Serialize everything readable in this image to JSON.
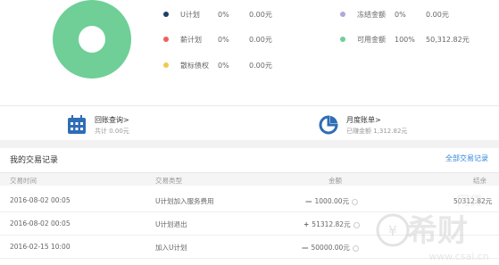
{
  "chart_data": {
    "type": "pie",
    "segments": [
      {
        "name": "U计划",
        "percent": 0,
        "amount": "0.00元",
        "color": "#1e3f66"
      },
      {
        "name": "薪计划",
        "percent": 0,
        "amount": "0.00元",
        "color": "#f0605a"
      },
      {
        "name": "散标债权",
        "percent": 0,
        "amount": "0.00元",
        "color": "#f2c94c"
      },
      {
        "name": "冻结金额",
        "percent": 0,
        "amount": "0.00元",
        "color": "#b3a7d9"
      },
      {
        "name": "可用金额",
        "percent": 100,
        "amount": "50,312.82元",
        "color": "#6fcf97"
      }
    ]
  },
  "legend": [
    {
      "name": "U计划",
      "pct": "0%",
      "amount": "0.00元",
      "color": "#1e3f66"
    },
    {
      "name": "薪计划",
      "pct": "0%",
      "amount": "0.00元",
      "color": "#f0605a"
    },
    {
      "name": "散标债权",
      "pct": "0%",
      "amount": "0.00元",
      "color": "#f2c94c"
    },
    {
      "name": "冻结金额",
      "pct": "0%",
      "amount": "0.00元",
      "color": "#b3a7d9"
    },
    {
      "name": "可用金额",
      "pct": "100%",
      "amount": "50,312.82元",
      "color": "#6fcf97"
    }
  ],
  "summary": {
    "refund": {
      "title": "回账查询>",
      "sub": "共计 0.00元",
      "icon": "calendar-icon"
    },
    "monthly": {
      "title": "月度账单>",
      "sub": "已赚金额 1,312.82元",
      "icon": "bill-icon"
    }
  },
  "transactions": {
    "title": "我的交易记录",
    "all_link": "全部交易记录",
    "headers": [
      "交易时间",
      "交易类型",
      "金额",
      "结余"
    ],
    "rows": [
      {
        "time": "2016-08-02 00:05",
        "type": "U计划加入服务费用",
        "sign": "—",
        "amount": "1000.00元",
        "balance": "50312.82元",
        "kind": "minus"
      },
      {
        "time": "2016-08-02 00:05",
        "type": "U计划退出",
        "sign": "+",
        "amount": "51312.82元",
        "balance": "",
        "kind": "plus"
      },
      {
        "time": "2016-02-15 10:00",
        "type": "加入U计划",
        "sign": "—",
        "amount": "50000.00元",
        "balance": "",
        "kind": "minus"
      }
    ]
  },
  "watermark": {
    "text": "希财",
    "site": "www.csai.cn",
    "tag": "网贷"
  }
}
